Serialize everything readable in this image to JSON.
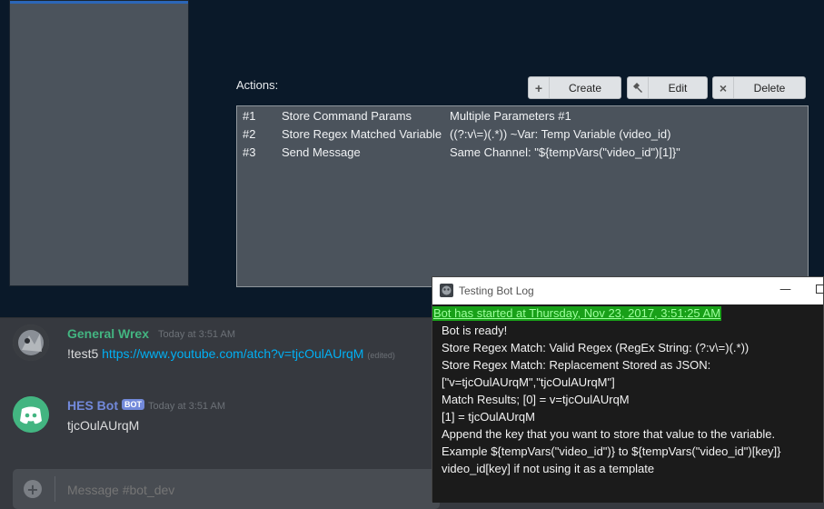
{
  "editor": {
    "actions_label": "Actions:",
    "buttons": {
      "create": "Create",
      "edit": "Edit",
      "delete": "Delete"
    },
    "actions": [
      {
        "num": "#1",
        "name": "Store Command Params",
        "detail": "Multiple Parameters #1"
      },
      {
        "num": "#2",
        "name": "Store Regex Matched Variable",
        "detail": "((?:v\\=)(.*)) ~Var: Temp Variable (video_id)"
      },
      {
        "num": "#3",
        "name": "Send Message",
        "detail": "Same Channel: \"${tempVars(\"video_id\")[1]}\""
      }
    ]
  },
  "chat": {
    "messages": [
      {
        "username": "General Wrex",
        "timestamp": "Today at 3:51 AM",
        "text": "!test5",
        "link": "https://www.youtube.com/atch?v=tjcOulAUrqM",
        "edited": "(edited)"
      },
      {
        "username": "HES Bot",
        "badge": "BOT",
        "timestamp": "Today at 3:51 AM",
        "text": "tjcOulAUrqM"
      }
    ],
    "input_placeholder": "Message #bot_dev"
  },
  "log": {
    "title": "Testing Bot Log",
    "header_line": "Bot has started at Thursday, Nov 23, 2017, 3:51:25 AM",
    "lines": [
      "Bot is ready!",
      "Store Regex Match: Valid Regex (RegEx String: (?:v\\=)(.*))",
      "Store Regex Match: Replacement Stored as JSON:",
      "[\"v=tjcOulAUrqM\",\"tjcOulAUrqM\"]",
      "Match Results;   [0] = v=tjcOulAUrqM",
      "[1] = tjcOulAUrqM",
      "Append the key that you want to store that value to the variable.",
      "Example ${tempVars(\"video_id\")} to ${tempVars(\"video_id\")[key]}",
      "video_id[key] if not using it as a template"
    ]
  },
  "colors": {
    "editor_bg": "#0a1929",
    "wrex_name": "#43b581",
    "bot_name": "#7289da",
    "link": "#00b0f4",
    "log_header": "#7cfc7c"
  }
}
